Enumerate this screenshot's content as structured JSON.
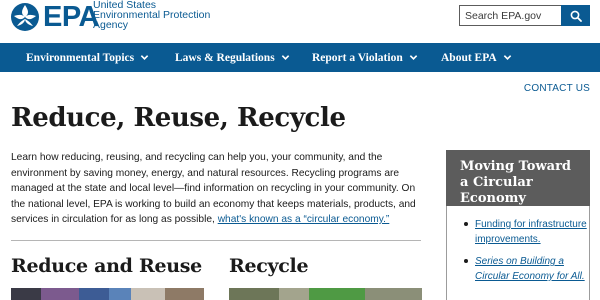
{
  "header": {
    "logo_text": "EPA",
    "agency_lines": [
      "United States",
      "Environmental Protection",
      "Agency"
    ],
    "search": {
      "placeholder": "Search EPA.gov",
      "button_icon": "search-icon"
    }
  },
  "nav": {
    "items": [
      {
        "label": "Environmental Topics"
      },
      {
        "label": "Laws & Regulations"
      },
      {
        "label": "Report a Violation"
      },
      {
        "label": "About EPA"
      }
    ]
  },
  "contact_label": "CONTACT US",
  "main": {
    "title": "Reduce, Reuse, Recycle",
    "intro_text": "Learn how reducing, reusing, and recycling can help you, your community, and the environment by saving money, energy, and natural resources. Recycling programs are managed at the state and local level—find information on recycling in your community. On the national level, EPA is working to build an economy that keeps materials, products, and services in circulation for as long as possible, ",
    "intro_link": "what's known as a “circular economy.”",
    "sections": [
      {
        "title": "Reduce and Reuse"
      },
      {
        "title": "Recycle"
      }
    ]
  },
  "sidebar": {
    "heading": "Moving Toward a Circular Economy",
    "links": [
      {
        "label": "Funding for infrastructure improvements.",
        "italic": false
      },
      {
        "label": "Series on Building a Circular Economy for All.",
        "italic": true
      }
    ]
  },
  "colors": {
    "brand_blue": "#0a5a92",
    "sidebar_header": "#5c5c5c",
    "text": "#1b1b1b"
  }
}
